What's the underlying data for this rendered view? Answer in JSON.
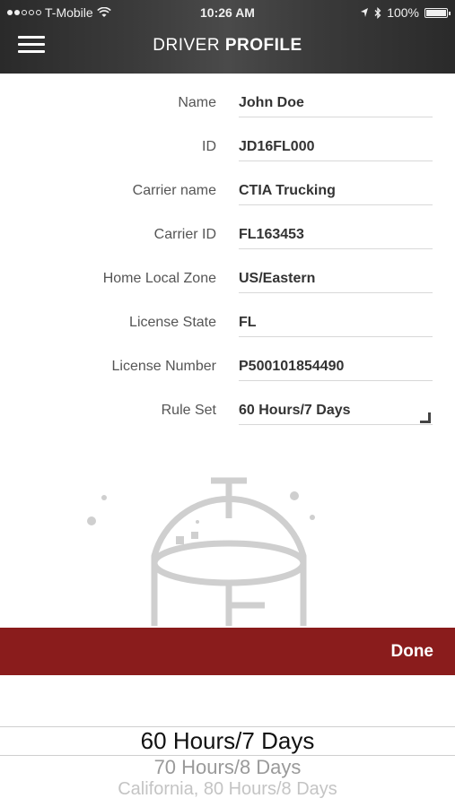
{
  "status_bar": {
    "carrier": "T-Mobile",
    "time": "10:26 AM",
    "battery": "100%",
    "signal_icon": "signal-dots-icon",
    "wifi_icon": "wifi-icon",
    "location_icon": "location-arrow-icon",
    "bluetooth_icon": "bluetooth-icon",
    "battery_icon": "battery-icon"
  },
  "header": {
    "title_light": "DRIVER ",
    "title_bold": "PROFILE",
    "menu_icon": "hamburger-menu-icon",
    "background": "#333333"
  },
  "fields": [
    {
      "label": "Name",
      "value": "John Doe"
    },
    {
      "label": "ID",
      "value": "JD16FL000"
    },
    {
      "label": "Carrier name",
      "value": "CTIA Trucking"
    },
    {
      "label": "Carrier ID",
      "value": "FL163453"
    },
    {
      "label": "Home Local Zone",
      "value": "US/Eastern"
    },
    {
      "label": "License State",
      "value": "FL"
    },
    {
      "label": "License Number",
      "value": "P500101854490"
    },
    {
      "label": "Rule Set",
      "value": "60 Hours/7 Days"
    }
  ],
  "illustration": {
    "icon": "driver-helmet-icon"
  },
  "done_bar": {
    "label": "Done",
    "color": "#8a1c1c"
  },
  "picker": {
    "options": [
      "60 Hours/7 Days",
      "70 Hours/8 Days",
      "California, 80 Hours/8 Days"
    ],
    "selected": "60 Hours/7 Days"
  }
}
